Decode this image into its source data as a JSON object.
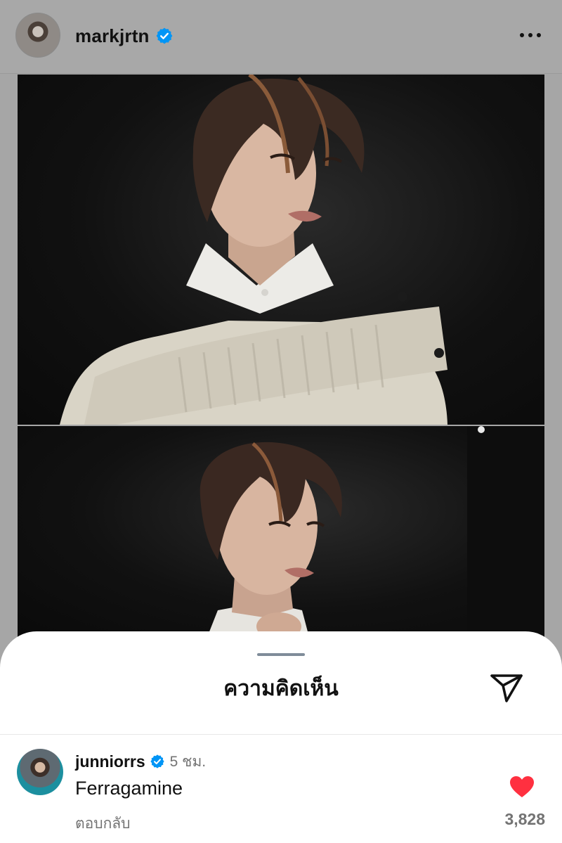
{
  "post": {
    "username": "markjrtn",
    "verified_icon": "verified-badge-icon",
    "more_icon": "more-options-icon"
  },
  "comments_sheet": {
    "title": "ความคิดเห็น",
    "share_icon": "send-icon"
  },
  "comments": [
    {
      "username": "junniorrs",
      "time": "5 ชม.",
      "text": "Ferragamine",
      "reply_label": "ตอบกลับ",
      "like_count": "3,828",
      "liked": true
    }
  ],
  "colors": {
    "verified": "#0095f6",
    "like": "#ff3040"
  }
}
